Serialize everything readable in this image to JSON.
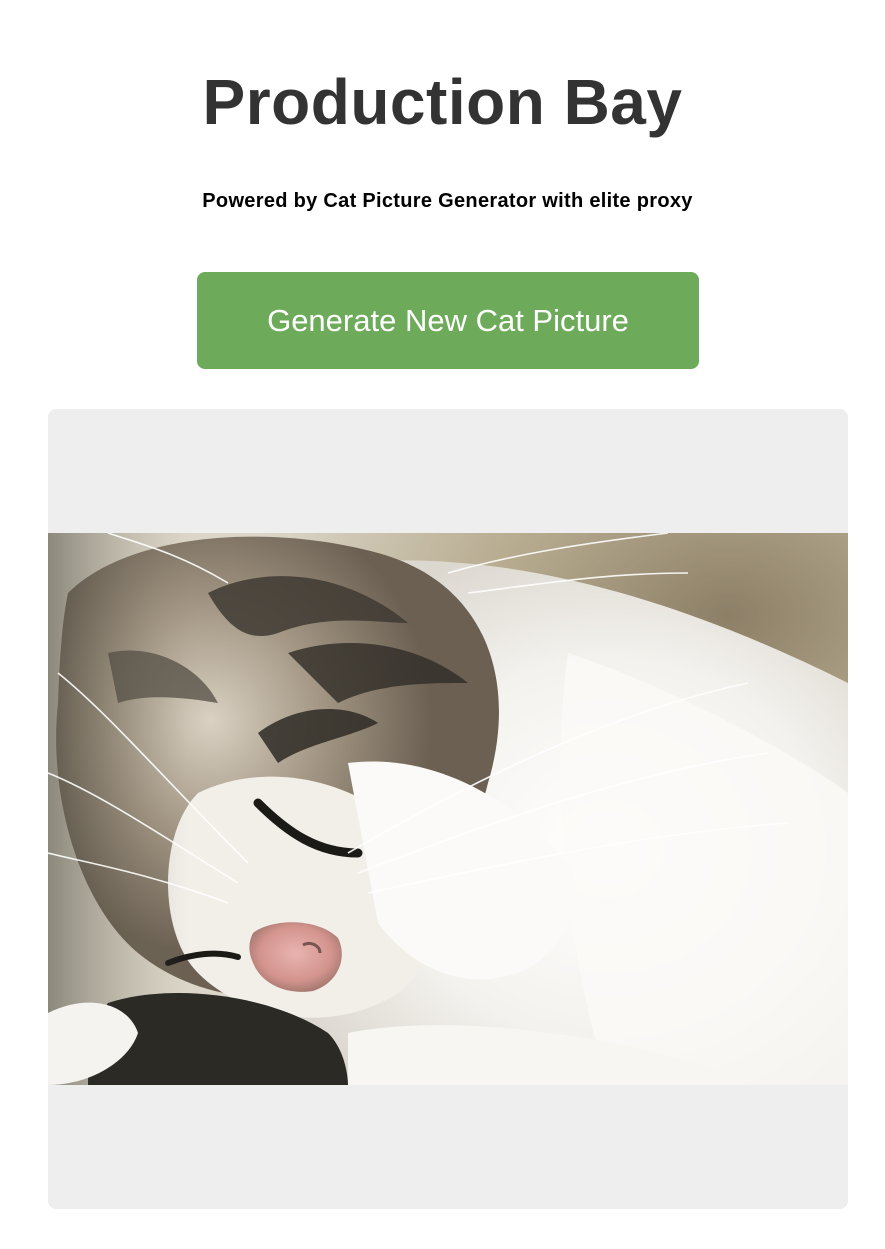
{
  "header": {
    "title": "Production Bay",
    "subtitle": "Powered by Cat Picture Generator with elite proxy"
  },
  "actions": {
    "generate_label": "Generate New Cat Picture"
  },
  "image": {
    "subject": "sleeping tabby-and-white cat close-up",
    "icon": "cat-photo"
  },
  "colors": {
    "button_bg": "#6dab5b",
    "button_text": "#ffffff",
    "panel_bg": "#eeeeee",
    "title_text": "#333333"
  }
}
